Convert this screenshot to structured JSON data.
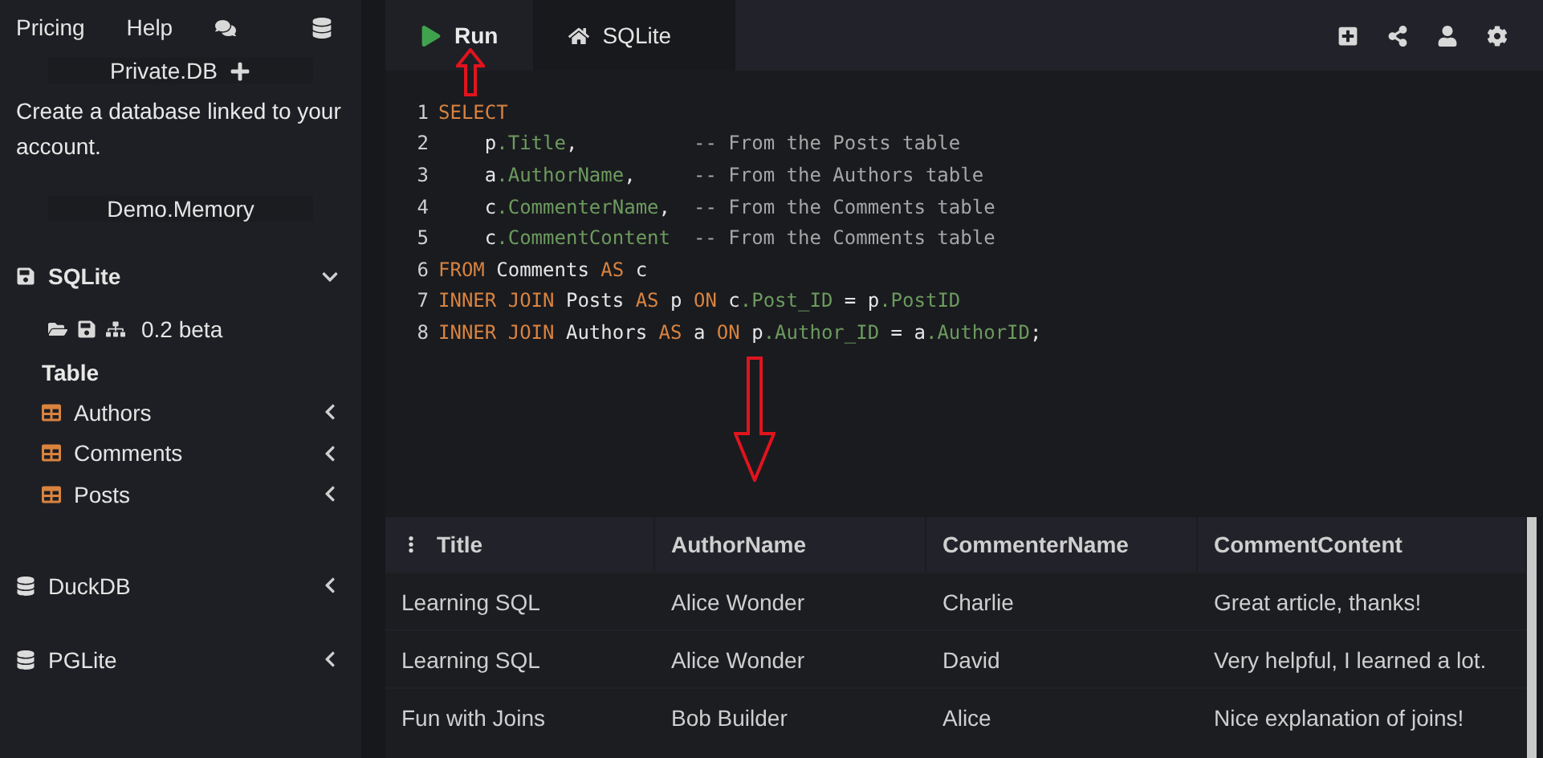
{
  "sidebar": {
    "top_links": [
      "Pricing",
      "Help"
    ],
    "private_db": {
      "label": "Private.DB",
      "description": "Create a database linked to your account."
    },
    "demo_button": "Demo.Memory",
    "engines": [
      {
        "kind": "sqlite",
        "name": "SQLite",
        "expanded": true,
        "version": "0.2 beta",
        "section_label": "Table",
        "tables": [
          {
            "name": "Authors",
            "expanded": false
          },
          {
            "name": "Comments",
            "expanded": false
          },
          {
            "name": "Posts",
            "expanded": false
          }
        ]
      },
      {
        "kind": "duckdb",
        "name": "DuckDB",
        "expanded": false
      },
      {
        "kind": "pglite",
        "name": "PGLite",
        "expanded": false
      }
    ]
  },
  "tabs": [
    {
      "kind": "run",
      "label": "Run",
      "selected": false
    },
    {
      "kind": "home",
      "label": "SQLite",
      "selected": true
    }
  ],
  "editor": {
    "lines": [
      {
        "number": "1",
        "tokens": [
          {
            "kind": "keyword",
            "text": "SELECT"
          }
        ]
      },
      {
        "number": "2",
        "tokens": [
          {
            "kind": "plain",
            "text": "    p"
          },
          {
            "kind": "field",
            "text": ".Title"
          },
          {
            "kind": "plain",
            "text": ",          "
          },
          {
            "kind": "comment",
            "text": "-- From the Posts table"
          }
        ]
      },
      {
        "number": "3",
        "tokens": [
          {
            "kind": "plain",
            "text": "    a"
          },
          {
            "kind": "field",
            "text": ".AuthorName"
          },
          {
            "kind": "plain",
            "text": ",     "
          },
          {
            "kind": "comment",
            "text": "-- From the Authors table"
          }
        ]
      },
      {
        "number": "4",
        "tokens": [
          {
            "kind": "plain",
            "text": "    c"
          },
          {
            "kind": "field",
            "text": ".CommenterName"
          },
          {
            "kind": "plain",
            "text": ",  "
          },
          {
            "kind": "comment",
            "text": "-- From the Comments table"
          }
        ]
      },
      {
        "number": "5",
        "tokens": [
          {
            "kind": "plain",
            "text": "    c"
          },
          {
            "kind": "field",
            "text": ".CommentContent"
          },
          {
            "kind": "comment",
            "text": "  -- From the Comments table"
          }
        ]
      },
      {
        "number": "6",
        "tokens": [
          {
            "kind": "keyword",
            "text": "FROM"
          },
          {
            "kind": "plain",
            "text": " Comments "
          },
          {
            "kind": "keyword",
            "text": "AS"
          },
          {
            "kind": "plain",
            "text": " c"
          }
        ]
      },
      {
        "number": "7",
        "tokens": [
          {
            "kind": "keyword",
            "text": "INNER JOIN"
          },
          {
            "kind": "plain",
            "text": " Posts "
          },
          {
            "kind": "keyword",
            "text": "AS"
          },
          {
            "kind": "plain",
            "text": " p "
          },
          {
            "kind": "keyword",
            "text": "ON"
          },
          {
            "kind": "plain",
            "text": " c"
          },
          {
            "kind": "field",
            "text": ".Post_ID"
          },
          {
            "kind": "plain",
            "text": " = p"
          },
          {
            "kind": "field",
            "text": ".PostID"
          }
        ]
      },
      {
        "number": "8",
        "tokens": [
          {
            "kind": "keyword",
            "text": "INNER JOIN"
          },
          {
            "kind": "plain",
            "text": " Authors "
          },
          {
            "kind": "keyword",
            "text": "AS"
          },
          {
            "kind": "plain",
            "text": " a "
          },
          {
            "kind": "keyword",
            "text": "ON"
          },
          {
            "kind": "plain",
            "text": " p"
          },
          {
            "kind": "field",
            "text": ".Author_ID"
          },
          {
            "kind": "plain",
            "text": " = a"
          },
          {
            "kind": "field",
            "text": ".AuthorID"
          },
          {
            "kind": "plain",
            "text": ";"
          }
        ]
      }
    ]
  },
  "results": {
    "columns": [
      "Title",
      "AuthorName",
      "CommenterName",
      "CommentContent"
    ],
    "rows": [
      [
        "Learning SQL",
        "Alice Wonder",
        "Charlie",
        "Great article, thanks!"
      ],
      [
        "Learning SQL",
        "Alice Wonder",
        "David",
        "Very helpful, I learned a lot."
      ],
      [
        "Fun with Joins",
        "Bob Builder",
        "Alice",
        "Nice explanation of joins!"
      ]
    ]
  }
}
